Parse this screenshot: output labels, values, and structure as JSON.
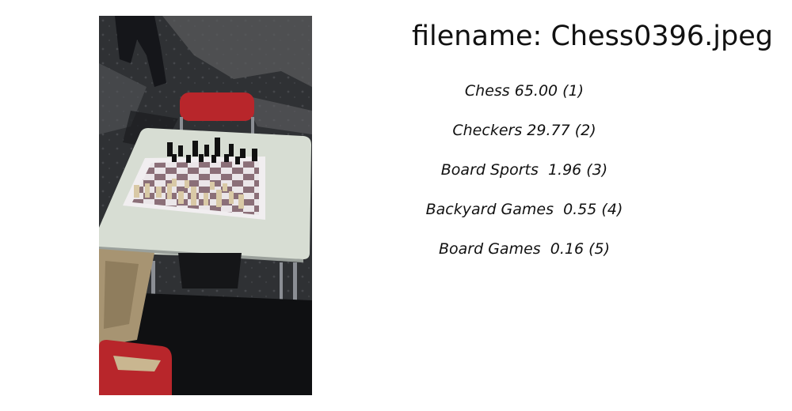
{
  "filename_label": "filename: Chess0396.jpeg",
  "image": {
    "icon": "chess-table-photo",
    "colors": {
      "pavement": "#2b2d30",
      "table_top": "#d7ddd3",
      "chair_red": "#b8262b"
    }
  },
  "predictions": [
    {
      "label": "Chess 65.00 (1)"
    },
    {
      "label": "Checkers 29.77 (2)"
    },
    {
      "label": "Board Sports  1.96 (3)"
    },
    {
      "label": "Backyard Games  0.55 (4)"
    },
    {
      "label": "Board Games  0.16 (5)"
    }
  ]
}
